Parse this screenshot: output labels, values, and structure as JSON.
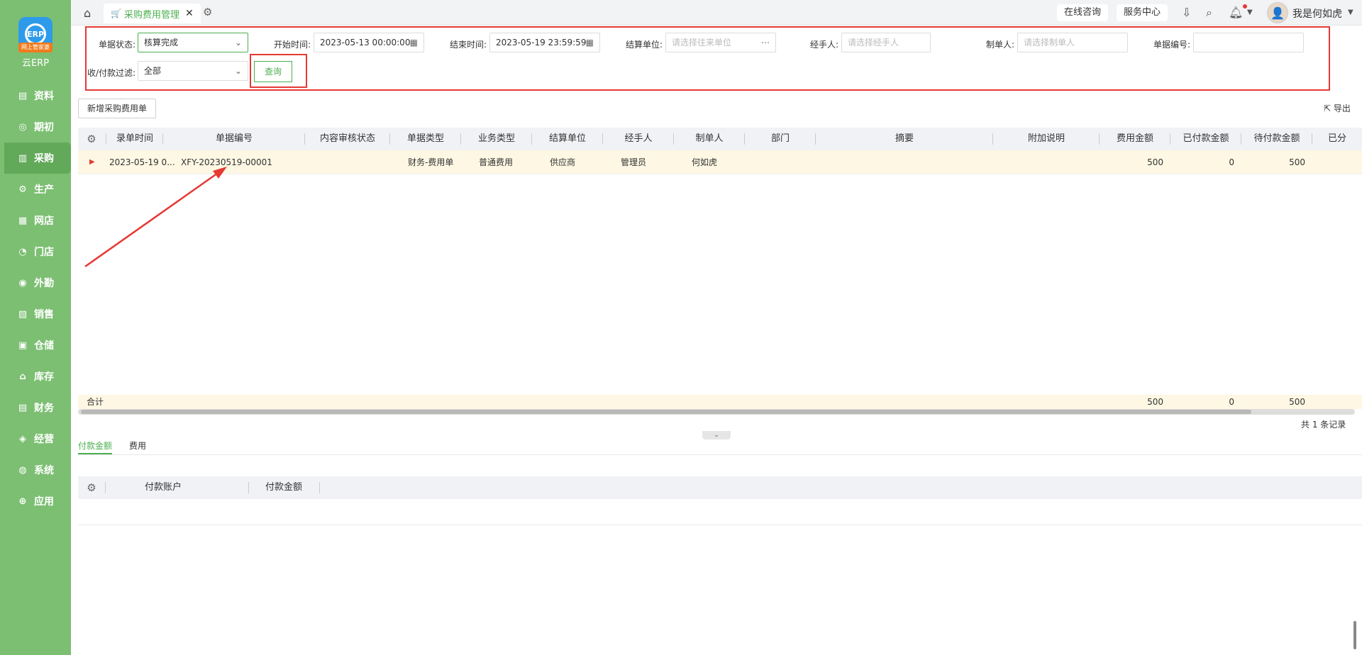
{
  "app": {
    "logo_badge": "网上管家婆",
    "logo_text": "云ERP"
  },
  "sidebar": {
    "items": [
      {
        "label": "资料",
        "icon": "data-icon"
      },
      {
        "label": "期初",
        "icon": "initial-icon"
      },
      {
        "label": "采购",
        "icon": "purchase-icon"
      },
      {
        "label": "生产",
        "icon": "production-icon"
      },
      {
        "label": "网店",
        "icon": "online-store-icon"
      },
      {
        "label": "门店",
        "icon": "store-icon"
      },
      {
        "label": "外勤",
        "icon": "field-icon"
      },
      {
        "label": "销售",
        "icon": "sales-icon"
      },
      {
        "label": "仓储",
        "icon": "warehouse-icon"
      },
      {
        "label": "库存",
        "icon": "inventory-icon"
      },
      {
        "label": "财务",
        "icon": "finance-icon"
      },
      {
        "label": "经营",
        "icon": "business-icon"
      },
      {
        "label": "系统",
        "icon": "system-icon"
      },
      {
        "label": "应用",
        "icon": "apps-icon"
      }
    ],
    "active_index": 2
  },
  "topbar": {
    "tab_label": "采购费用管理",
    "online_consult": "在线咨询",
    "service_center": "服务中心",
    "username": "我是何如虎"
  },
  "filters": {
    "status_label": "单据状态:",
    "status_value": "核算完成",
    "start_label": "开始时间:",
    "start_value": "2023-05-13 00:00:00",
    "end_label": "结束时间:",
    "end_value": "2023-05-19 23:59:59",
    "settle_label": "结算单位:",
    "settle_placeholder": "请选择往来单位",
    "handler_label": "经手人:",
    "handler_placeholder": "请选择经手人",
    "maker_label": "制单人:",
    "maker_placeholder": "请选择制单人",
    "docno_label": "单据编号:",
    "docno_value": "",
    "payfilter_label": "收/付款过滤:",
    "payfilter_value": "全部",
    "query_button": "查询"
  },
  "toolbar": {
    "add_button": "新增采购费用单",
    "export": "导出"
  },
  "table": {
    "columns": [
      "录单时间",
      "单据编号",
      "内容审核状态",
      "单据类型",
      "业务类型",
      "结算单位",
      "经手人",
      "制单人",
      "部门",
      "摘要",
      "附加说明",
      "费用金额",
      "已付款金额",
      "待付款金额",
      "已分"
    ],
    "rows": [
      {
        "time": "2023-05-19 0...",
        "docno": "XFY-20230519-00001",
        "audit": "",
        "doctype": "财务-费用单",
        "biztype": "普通费用",
        "settle": "供应商",
        "handler": "管理员",
        "maker": "何如虎",
        "dept": "",
        "summary": "",
        "note": "",
        "amount": "500",
        "paid": "0",
        "unpaid": "500"
      }
    ],
    "footer": {
      "label": "合计",
      "amount": "500",
      "paid": "0",
      "unpaid": "500"
    },
    "record_count": "共 1 条记录"
  },
  "lower": {
    "tabs": [
      "付款金额",
      "费用"
    ],
    "columns": [
      "付款账户",
      "付款金额"
    ]
  }
}
